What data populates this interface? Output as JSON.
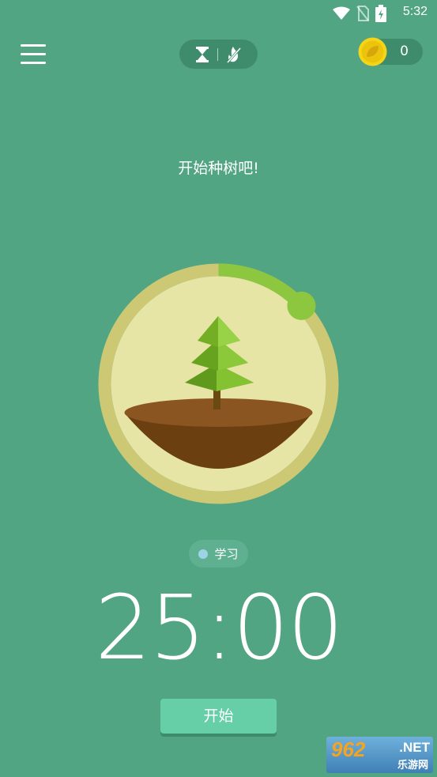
{
  "status_bar": {
    "time": "5:32"
  },
  "header": {
    "mode_icons": [
      "hourglass-icon",
      "no-fire-icon"
    ],
    "coins": "0"
  },
  "prompt": "开始种树吧!",
  "tag": {
    "label": "学习",
    "color": "#9dd3e6"
  },
  "timer": "25:00",
  "start_button": "开始",
  "progress": {
    "fraction": 0.13
  },
  "watermark": {
    "main": "962",
    "suffix": ".NET",
    "sub": "乐游网"
  },
  "colors": {
    "background": "#52a583",
    "ring": "#cdc873",
    "ring_progress": "#8dc63f",
    "inner_disc": "#e6e5a6",
    "soil": "#6b3f0f",
    "button": "#66cfa8"
  }
}
